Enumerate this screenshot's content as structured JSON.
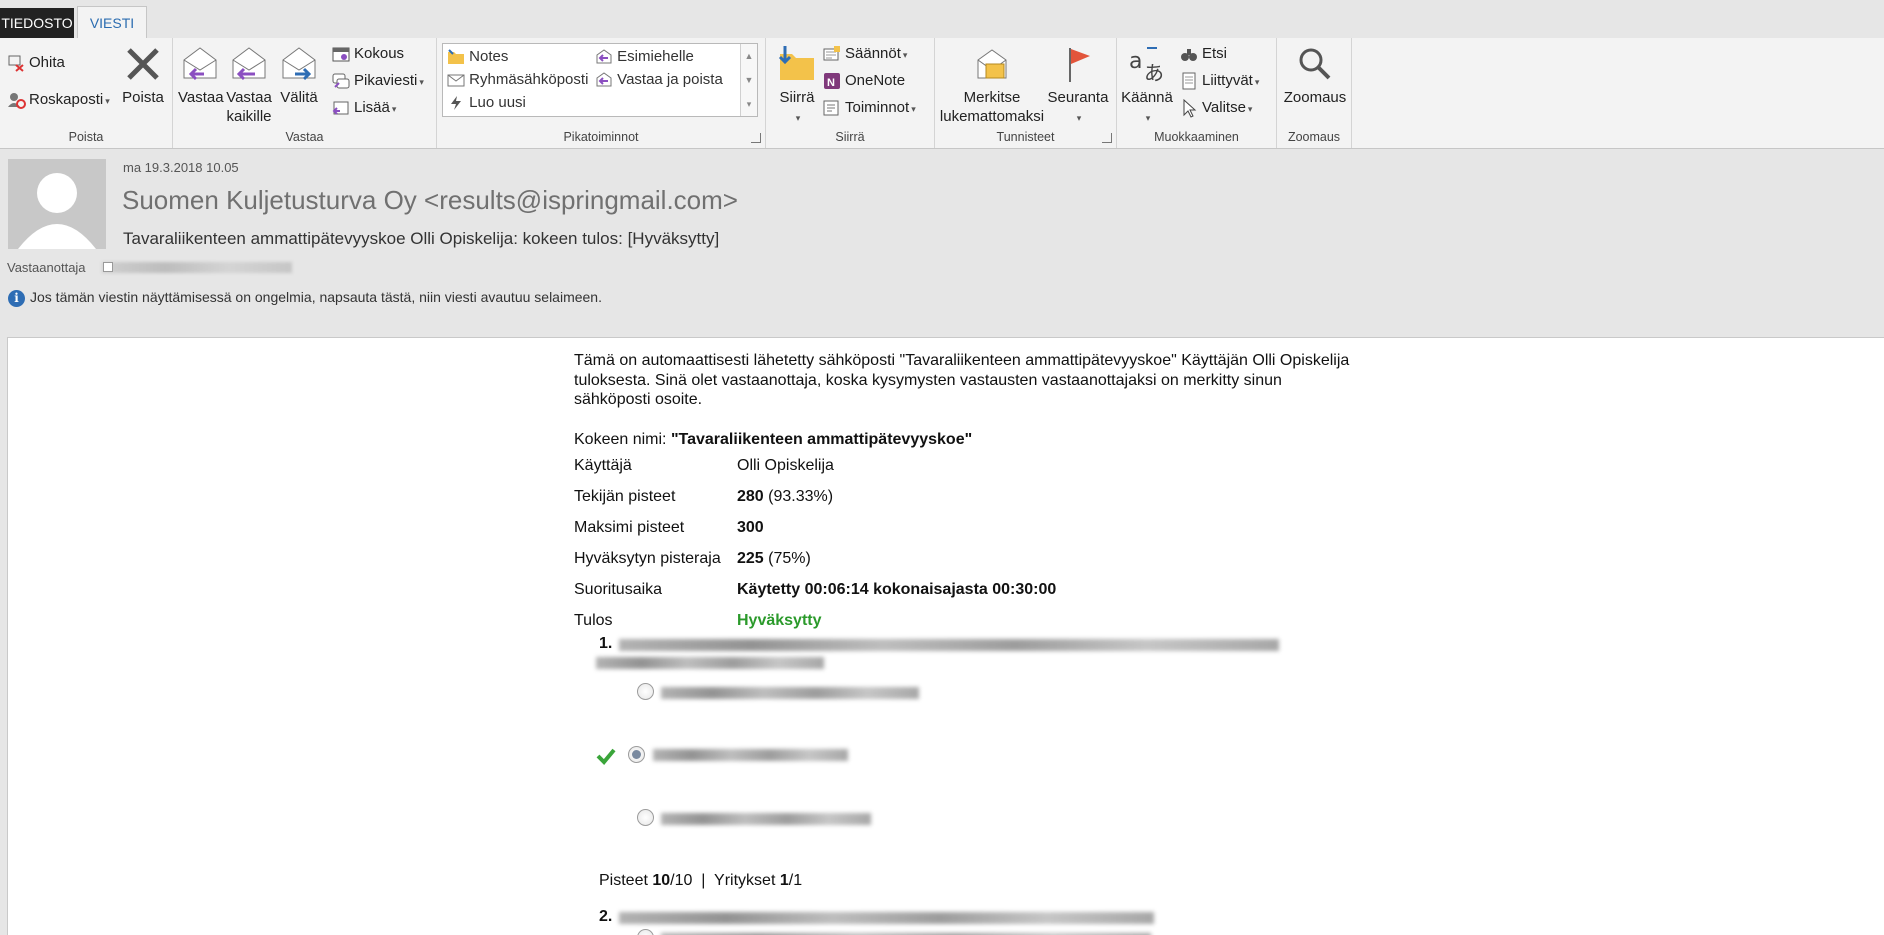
{
  "tabs": {
    "file": "TIEDOSTO",
    "message": "VIESTI"
  },
  "ribbon": {
    "groups": {
      "delete": "Poista",
      "respond": "Vastaa",
      "quicksteps": "Pikatoiminnot",
      "move": "Siirrä",
      "tags": "Tunnisteet",
      "editing": "Muokkaaminen",
      "zoom": "Zoomaus"
    },
    "ignore": "Ohita",
    "junk": "Roskaposti",
    "delete_btn": "Poista",
    "reply": [
      "Vastaa"
    ],
    "reply_all": [
      "Vastaa",
      "kaikille"
    ],
    "forward": "Välitä",
    "meeting": "Kokous",
    "im": "Pikaviesti",
    "more": "Lisää",
    "quick": {
      "notes": "Notes",
      "to_manager": "Esimiehelle",
      "team_email": "Ryhmäsähköposti",
      "reply_delete": "Vastaa ja poista",
      "create_new": "Luo uusi"
    },
    "move_btn": "Siirrä",
    "rules": "Säännöt",
    "onenote": "OneNote",
    "actions": "Toiminnot",
    "mark_unread": [
      "Merkitse",
      "lukemattomaksi"
    ],
    "follow_up": "Seuranta",
    "translate": "Käännä",
    "find": "Etsi",
    "related": "Liittyvät",
    "select": "Valitse",
    "zoom_btn": "Zoomaus"
  },
  "message": {
    "date": "ma 19.3.2018 10.05",
    "sender": "Suomen Kuljetusturva Oy <results@ispringmail.com>",
    "subject": "Tavaraliikenteen ammattipätevyyskoe Olli Opiskelija: kokeen tulos: [Hyväksytty]",
    "to_label": "Vastaanottaja",
    "info": "Jos tämän viestin näyttämisessä on ongelmia, napsauta tästä, niin viesti avautuu selaimeen."
  },
  "body": {
    "intro": "Tämä on automaattisesti lähetetty sähköposti \"Tavaraliikenteen ammattipätevyyskoe\" Käyttäjän Olli Opiskelija tuloksesta. Sinä olet vastaanottaja, koska kysymysten vastausten vastaanottajaksi on merkitty sinun sähköposti osoite.",
    "exam_label": "Kokeen nimi: ",
    "exam_name": "\"Tavaraliikenteen ammattipätevyyskoe\"",
    "rows": [
      {
        "k": "Käyttäjä",
        "v": "Olli Opiskelija"
      },
      {
        "k": "Tekijän pisteet",
        "vb": "280",
        "vr": " (93.33%)"
      },
      {
        "k": "Maksimi pisteet",
        "vb": "300"
      },
      {
        "k": "Hyväksytyn pisteraja",
        "vb": "225",
        "vr": " (75%)"
      },
      {
        "k": "Suoritusaika",
        "vb": "Käytetty 00:06:14 kokonaisajasta 00:30:00"
      },
      {
        "k": "Tulos",
        "pass": "Hyväksytty"
      }
    ],
    "q1_num": "1.",
    "q2_num": "2.",
    "score_prefix": "Pisteet ",
    "score_val": "10",
    "score_mid": "/10  |  Yritykset ",
    "attempts_val": "1",
    "attempts_suffix": "/1"
  }
}
